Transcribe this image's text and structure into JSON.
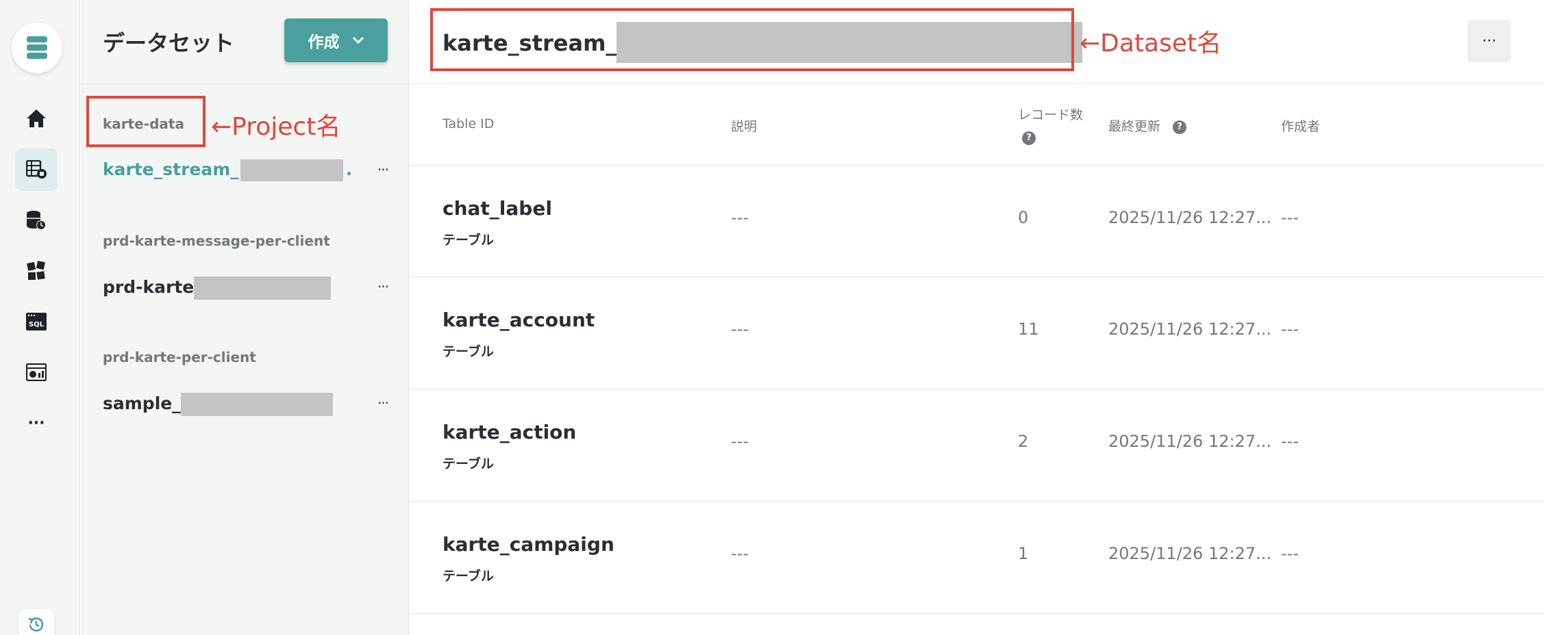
{
  "colors": {
    "accent": "#4a9f9f",
    "annotation": "#e0473a",
    "redaction": "#c4c4c4"
  },
  "rail": {
    "icons": [
      "database-logo-icon",
      "home-icon",
      "dataset-icon",
      "data-storage-icon",
      "blocks-icon",
      "sql-icon",
      "dashboard-icon",
      "more-icon",
      "history-icon"
    ],
    "sql_label": "SQL",
    "more_label": "···"
  },
  "sidebar": {
    "title": "データセット",
    "create_label": "作成",
    "projects": [
      {
        "name": "karte-data",
        "datasets": [
          {
            "name": "karte_stream_",
            "suffix": "."
          }
        ]
      },
      {
        "name": "prd-karte-message-per-client",
        "datasets": [
          {
            "name": "prd-karte",
            "suffix": ""
          }
        ]
      },
      {
        "name": "prd-karte-per-client",
        "datasets": [
          {
            "name": "sample_",
            "suffix": ""
          }
        ]
      }
    ],
    "more_label": "···"
  },
  "main": {
    "title": "karte_stream_",
    "more_label": "···",
    "columns": {
      "table_id": "Table ID",
      "description": "説明",
      "records": "レコード数",
      "updated": "最終更新",
      "creator": "作成者"
    },
    "help_glyph": "?",
    "rows": [
      {
        "id": "chat_label",
        "type": "テーブル",
        "description": "---",
        "records": "0",
        "updated": "2025/11/26 12:27...",
        "creator": "---"
      },
      {
        "id": "karte_account",
        "type": "テーブル",
        "description": "---",
        "records": "11",
        "updated": "2025/11/26 12:27...",
        "creator": "---"
      },
      {
        "id": "karte_action",
        "type": "テーブル",
        "description": "---",
        "records": "2",
        "updated": "2025/11/26 12:27...",
        "creator": "---"
      },
      {
        "id": "karte_campaign",
        "type": "テーブル",
        "description": "---",
        "records": "1",
        "updated": "2025/11/26 12:27...",
        "creator": "---"
      }
    ]
  },
  "annotations": {
    "project": "←Project名",
    "dataset": "←Dataset名"
  }
}
